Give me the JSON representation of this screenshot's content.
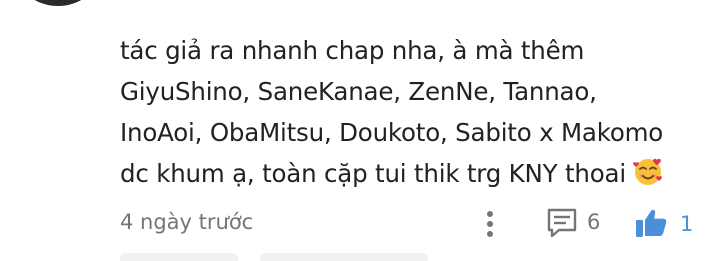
{
  "comment": {
    "lines": [
      "tác giả ra nhanh chap nha, à mà thêm",
      "GiyuShino, SaneKanae, ZenNe, Tannao,",
      "InoAoi, ObaMitsu, Doukoto, Sabito x Makomo",
      "dc khum ạ, toàn cặp tui thik trg KNY thoai"
    ],
    "emoji": "smiling-face-with-hearts-icon"
  },
  "meta": {
    "timestamp": "4 ngày trước",
    "reply_count": "6",
    "like_count": "1"
  },
  "colors": {
    "text": "#222222",
    "muted": "#757575",
    "like_blue": "#4a90d9"
  }
}
